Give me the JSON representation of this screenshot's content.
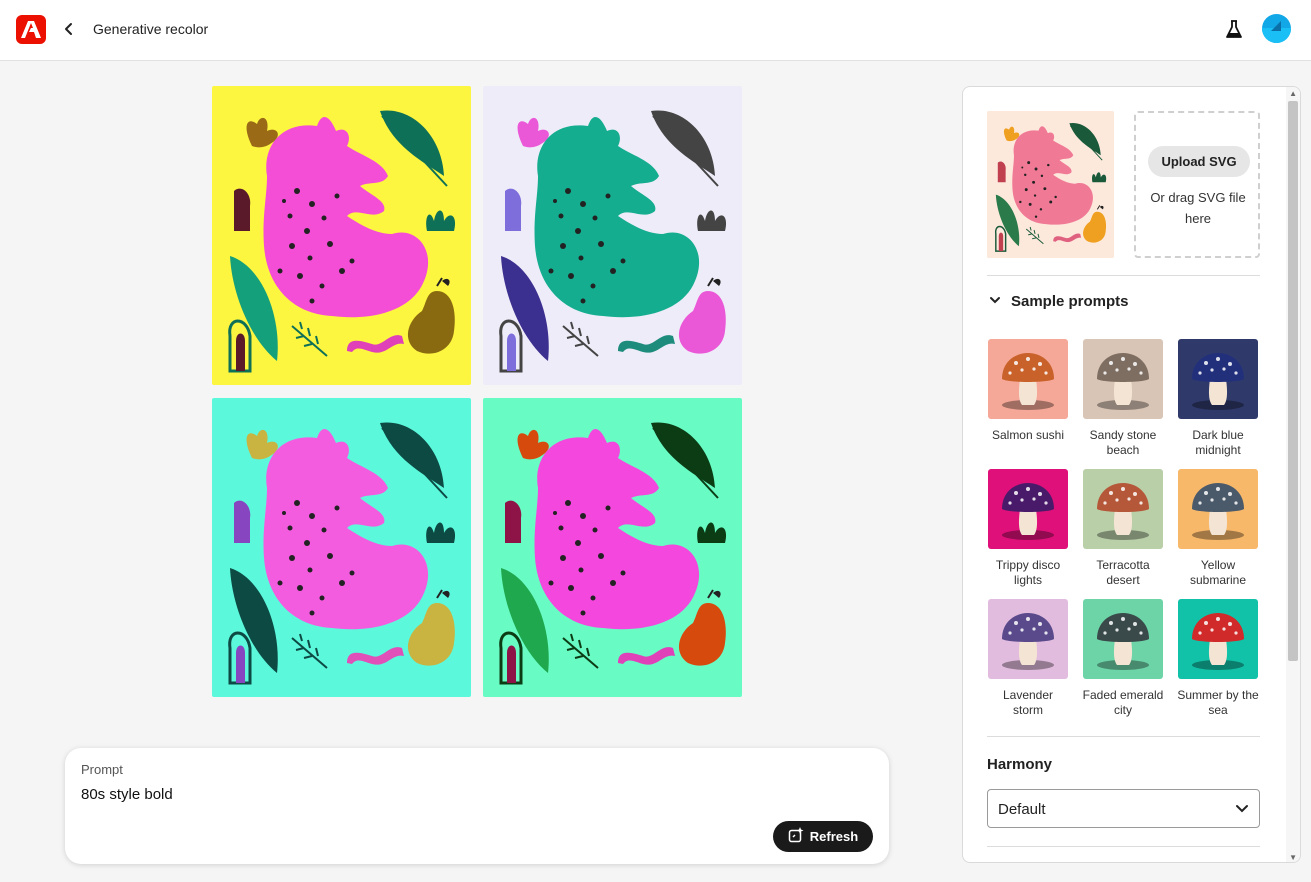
{
  "header": {
    "title": "Generative recolor",
    "logo": "adobe-logo",
    "back_icon": "chevron-left-icon",
    "labs_icon": "flask-icon"
  },
  "variations": [
    {
      "bg": "#fdf640",
      "cat": "#f44dd6",
      "leaf": "#0f7058",
      "leaf2": "#14a07a",
      "accent": "#9a6a16",
      "pear": "#8a6a10",
      "arch": "#5a1a2a",
      "wave": "#e040b8"
    },
    {
      "bg": "#efecf9",
      "cat": "#15ad8f",
      "leaf": "#444444",
      "leaf2": "#3b2f8f",
      "accent": "#ea58d8",
      "pear": "#ea58d8",
      "arch": "#7d6edc",
      "wave": "#1e8c7c"
    },
    {
      "bg": "#5cf8dc",
      "cat": "#f45ce0",
      "leaf": "#0c4a43",
      "leaf2": "#0c4a43",
      "accent": "#c9b341",
      "pear": "#c9b341",
      "arch": "#8845c0",
      "wave": "#e050b8"
    },
    {
      "bg": "#69fbc4",
      "cat": "#f447dd",
      "leaf": "#0b3c14",
      "leaf2": "#1fa84e",
      "accent": "#d74a0e",
      "pear": "#d74a0e",
      "arch": "#8e1448",
      "wave": "#e040b8"
    }
  ],
  "prompt": {
    "label": "Prompt",
    "value": "80s style bold",
    "refresh_label": "Refresh"
  },
  "panel": {
    "upload_label": "Upload SVG",
    "upload_hint": "Or drag SVG file here",
    "sample_prompts_title": "Sample prompts",
    "samples": [
      {
        "label": "Salmon sushi",
        "bg": "#f6a898",
        "cap": "#c8612a"
      },
      {
        "label": "Sandy stone beach",
        "bg": "#d9c5b6",
        "cap": "#7e6e62"
      },
      {
        "label": "Dark blue midnight",
        "bg": "#2f3a6b",
        "cap": "#22307c"
      },
      {
        "label": "Trippy disco lights",
        "bg": "#e0107a",
        "cap": "#4a1a6a"
      },
      {
        "label": "Terracotta desert",
        "bg": "#b9cfa8",
        "cap": "#b5583a"
      },
      {
        "label": "Yellow submarine",
        "bg": "#f8b86a",
        "cap": "#4a5a6a"
      },
      {
        "label": "Lavender storm",
        "bg": "#e2bcde",
        "cap": "#5a4a8c"
      },
      {
        "label": "Faded emerald city",
        "bg": "#6dd4a8",
        "cap": "#3a4a4a"
      },
      {
        "label": "Summer by the sea",
        "bg": "#12c2a8",
        "cap": "#d02a2a"
      }
    ],
    "harmony_title": "Harmony",
    "harmony_value": "Default"
  }
}
